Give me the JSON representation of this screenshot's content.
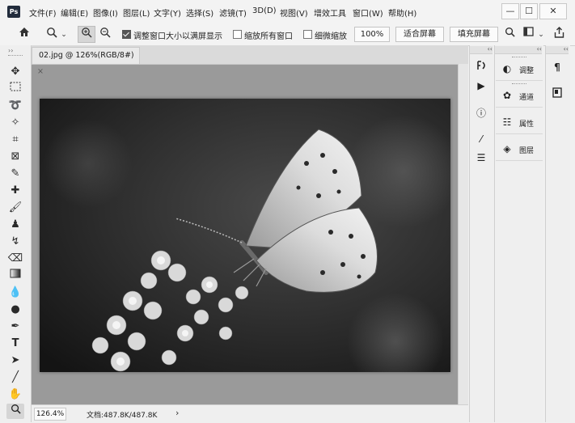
{
  "app": {
    "logo": "Ps",
    "menu": [
      "文件(F)",
      "编辑(E)",
      "图像(I)",
      "图层(L)",
      "文字(Y)",
      "选择(S)",
      "滤镜(T)",
      "3D(D)",
      "视图(V)",
      "增效工具",
      "窗口(W)",
      "帮助(H)"
    ],
    "window_controls": {
      "minimize": "—",
      "maximize": "☐",
      "close": "✕"
    }
  },
  "options": {
    "home_icon": "home-icon",
    "zoom_icon": "zoom-icon",
    "zoom_in_icon": "zoom-in-icon",
    "zoom_out_icon": "zoom-out-icon",
    "resize_windows_label": "调整窗口大小以满屏显示",
    "resize_windows_checked": true,
    "zoom_all_label": "缩放所有窗口",
    "zoom_all_checked": false,
    "scrubby_zoom_label": "细微缩放",
    "scrubby_zoom_checked": false,
    "zoom_value": "100%",
    "fit_screen_label": "适合屏幕",
    "fill_screen_label": "填充屏幕"
  },
  "document": {
    "tab_title": "02.jpg @ 126%(RGB/8#)",
    "tab_close": "×"
  },
  "status": {
    "zoom": "126.4%",
    "doc_info": "文档:487.8K/487.8K",
    "arrow": "›"
  },
  "panels": {
    "collapse": "‹‹",
    "items": [
      {
        "label": "调整",
        "icon": "adjustments-icon"
      },
      {
        "label": "通道",
        "icon": "channels-icon"
      },
      {
        "label": "属性",
        "icon": "properties-icon"
      },
      {
        "label": "图层",
        "icon": "layers-icon"
      }
    ]
  },
  "colors": {
    "accent": "#1473e6",
    "canvas_bg": "#9a9a9a"
  }
}
